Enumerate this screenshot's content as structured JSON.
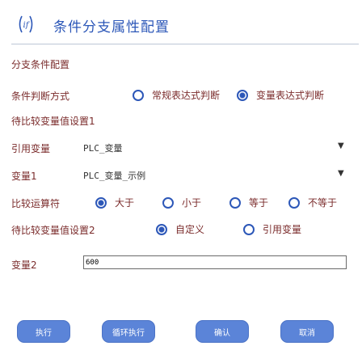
{
  "header": {
    "title": "条件分支属性配置",
    "icon": "if-condition-icon"
  },
  "section": {
    "label": "分支条件配置"
  },
  "mode": {
    "label": "条件判断方式",
    "options": [
      {
        "label": "常规表达式判断",
        "selected": false
      },
      {
        "label": "变量表达式判断",
        "selected": true
      }
    ]
  },
  "plc_var1": {
    "label": "待比较变量值设置1"
  },
  "ref_var": {
    "label": "引用变量",
    "value": "PLC_变量"
  },
  "variable1": {
    "label": "变量1",
    "value": "PLC_变量_示例"
  },
  "compare": {
    "label": "比较运算符",
    "options": [
      {
        "label": "大于",
        "selected": true
      },
      {
        "label": "小于",
        "selected": false
      },
      {
        "label": "等于",
        "selected": false
      },
      {
        "label": "不等于",
        "selected": false
      }
    ]
  },
  "plc_var2": {
    "label": "待比较变量值设置2",
    "options": [
      {
        "label": "自定义",
        "selected": true
      },
      {
        "label": "引用变量",
        "selected": false
      }
    ]
  },
  "variable2": {
    "label": "变量2",
    "value": "600"
  },
  "buttons": {
    "execute": "执行",
    "loop_execute": "循环执行",
    "confirm": "确认",
    "cancel": "取消"
  }
}
